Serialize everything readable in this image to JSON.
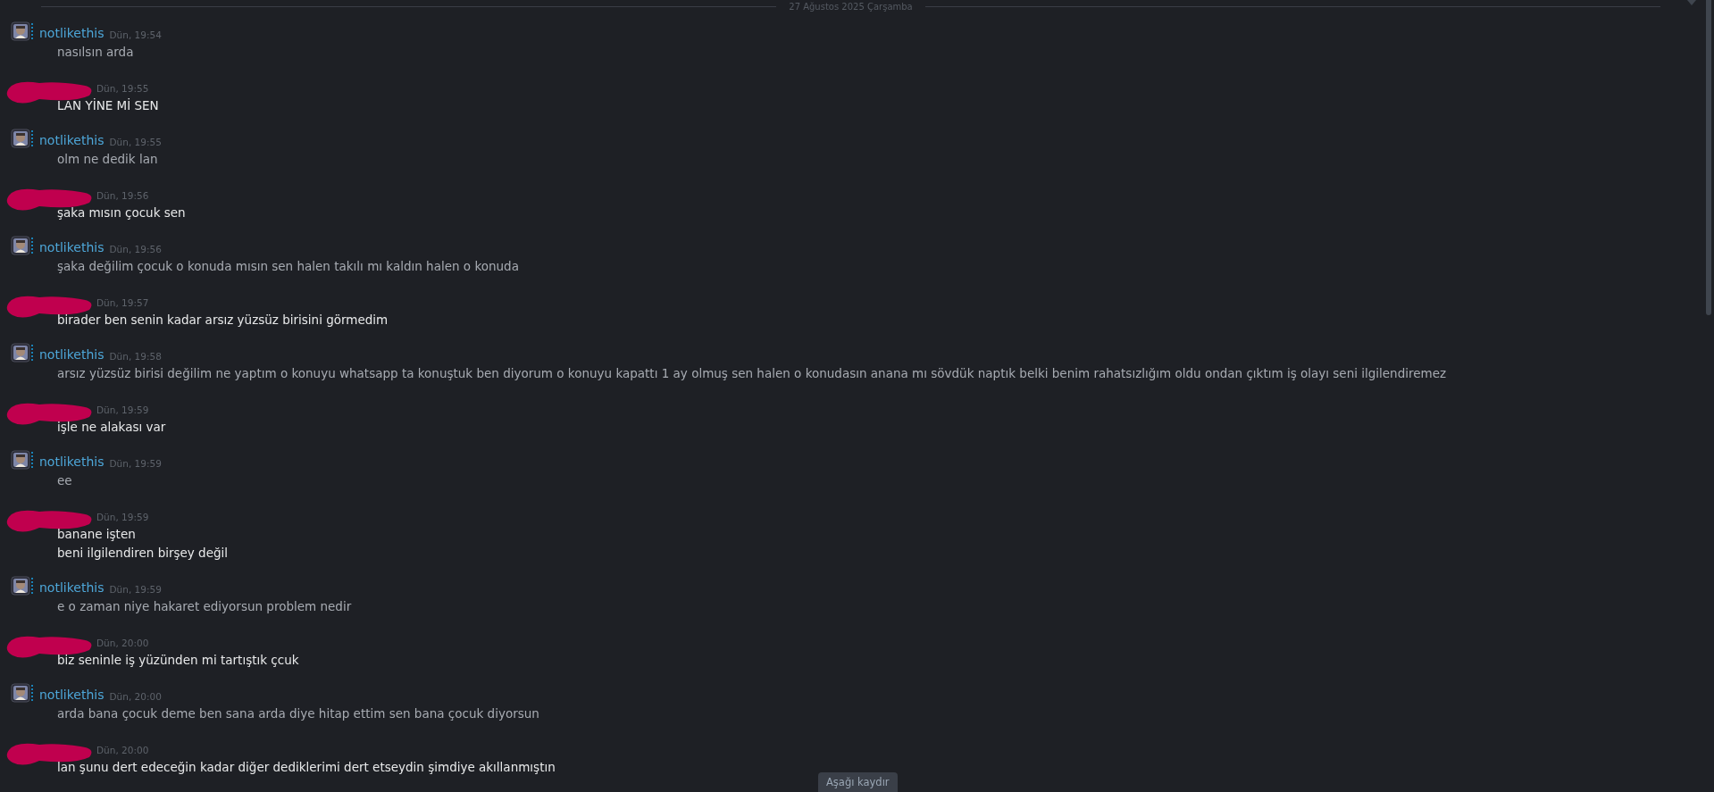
{
  "date_divider": "27 Ağustos 2025 Çarşamba",
  "messages": [
    {
      "kind": "named",
      "author": "notlikethis",
      "time": "Dün, 19:54",
      "lines": [
        "nasılsın arda"
      ]
    },
    {
      "kind": "redacted",
      "time": "Dün, 19:55",
      "lines": [
        "LAN YİNE Mİ SEN"
      ]
    },
    {
      "kind": "named",
      "author": "notlikethis",
      "time": "Dün, 19:55",
      "lines": [
        "olm ne dedik lan"
      ]
    },
    {
      "kind": "redacted",
      "time": "Dün, 19:56",
      "lines": [
        "şaka mısın çocuk sen"
      ]
    },
    {
      "kind": "named",
      "author": "notlikethis",
      "time": "Dün, 19:56",
      "lines": [
        "şaka değilim çocuk o konuda mısın sen halen takılı mı kaldın halen o konuda"
      ]
    },
    {
      "kind": "redacted",
      "time": "Dün, 19:57",
      "lines": [
        "birader ben senin kadar arsız yüzsüz birisini görmedim"
      ]
    },
    {
      "kind": "named",
      "author": "notlikethis",
      "time": "Dün, 19:58",
      "lines": [
        "arsız yüzsüz birisi değilim ne yaptım o konuyu whatsapp ta konuştuk ben diyorum o konuyu kapattı 1 ay olmuş sen halen o konudasın anana mı sövdük naptık belki benim rahatsızlığım oldu ondan çıktım iş olayı seni ilgilendiremez"
      ]
    },
    {
      "kind": "redacted",
      "time": "Dün, 19:59",
      "lines": [
        "işle ne alakası var"
      ]
    },
    {
      "kind": "named",
      "author": "notlikethis",
      "time": "Dün, 19:59",
      "lines": [
        "ee"
      ]
    },
    {
      "kind": "redacted",
      "time": "Dün, 19:59",
      "lines": [
        "banane işten",
        "beni ilgilendiren birşey değil"
      ]
    },
    {
      "kind": "named",
      "author": "notlikethis",
      "time": "Dün, 19:59",
      "lines": [
        "e o zaman niye hakaret ediyorsun problem nedir"
      ]
    },
    {
      "kind": "redacted",
      "time": "Dün, 20:00",
      "lines": [
        "biz seninle iş yüzünden mi tartıştık çcuk"
      ]
    },
    {
      "kind": "named",
      "author": "notlikethis",
      "time": "Dün, 20:00",
      "lines": [
        "arda bana çocuk deme ben sana arda diye hitap ettim sen bana çocuk diyorsun"
      ]
    },
    {
      "kind": "redacted",
      "time": "Dün, 20:00",
      "lines": [
        "lan şunu dert edeceğin kadar diğer dediklerimi dert etseydin şimdiye akıllanmıştın"
      ]
    }
  ],
  "scroll_button": "Aşağı kaydır"
}
